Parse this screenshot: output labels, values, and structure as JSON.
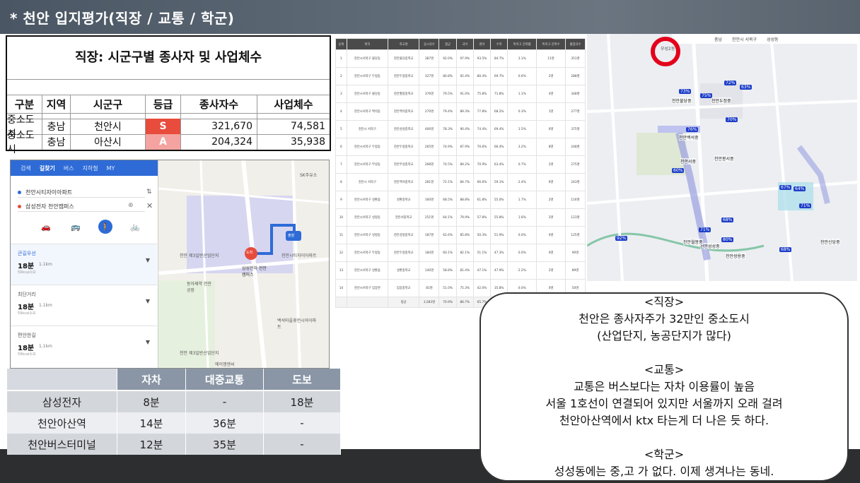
{
  "slide": {
    "title": "* 천안 입지평가(직장 / 교통 / 학군)"
  },
  "biz_table": {
    "title": "직장: 시군구별 종사자 및 사업체수",
    "headers": [
      "구분",
      "지역",
      "시군구",
      "등급",
      "종사자수",
      "사업체수"
    ],
    "rows": [
      {
        "type": "중소도시",
        "region": "충남",
        "city": "천안시",
        "grade": "S",
        "workers": "321,670",
        "businesses": "74,581"
      },
      {
        "type": "중소도시",
        "region": "충남",
        "city": "아산시",
        "grade": "A",
        "workers": "204,324",
        "businesses": "35,938"
      }
    ]
  },
  "map_app": {
    "tabs": [
      "검색",
      "길찾기",
      "버스",
      "지하철",
      "MY"
    ],
    "origin": "천안시티자이아파트",
    "destination": "삼성전자 천안캠퍼스",
    "options": [
      {
        "name": "큰길우선",
        "time": "18분",
        "dist": "1.1km",
        "sub": "59kcal소모"
      },
      {
        "name": "최단거리",
        "time": "18분",
        "dist": "1.1km",
        "sub": "59kcal소모"
      },
      {
        "name": "편안한길",
        "time": "18분",
        "dist": "1.1km",
        "sub": "59kcal소모"
      }
    ],
    "map_labels": {
      "a": "SK주유소",
      "b": "천안시티자이아파트",
      "c": "삼성전자 천안캠퍼스",
      "d": "천안 제3일반산업단지",
      "e": "동아제약 천안공장",
      "f": "백석마을휴먼시아아파트",
      "g": "천안 제3일반산업단지",
      "h": "에이엠엔씨",
      "i": "도착",
      "j": "출발"
    }
  },
  "travel_table": {
    "headers": [
      "",
      "자차",
      "대중교통",
      "도보"
    ],
    "rows": [
      [
        "삼성전자",
        "8분",
        "-",
        "18분"
      ],
      [
        "천안아산역",
        "14분",
        "36분",
        "-"
      ],
      [
        "천안버스터미널",
        "12분",
        "35분",
        "-"
      ]
    ]
  },
  "school_table": {
    "headers": [
      "순위",
      "위치",
      "학교명",
      "응시자수",
      "평균",
      "국어",
      "영어",
      "수학",
      "특목고 진학률",
      "특목고 진학수",
      "졸업자수"
    ],
    "rows": [
      [
        "1",
        "천안시서북구 불당동",
        "천안불당중학교",
        "387명",
        "92.0%",
        "97.9%",
        "93.5%",
        "84.7%",
        "3.1%",
        "11명",
        "351명"
      ],
      [
        "2",
        "천안시서북구 두정동",
        "천안두정중학교",
        "327명",
        "80.8%",
        "92.4%",
        "80.4%",
        "69.7%",
        "0.6%",
        "2명",
        "288명"
      ],
      [
        "3",
        "천안시서북구 불당동",
        "천안월봉중학교",
        "376명",
        "79.5%",
        "91.0%",
        "75.8%",
        "71.8%",
        "1.1%",
        "4명",
        "348명"
      ],
      [
        "4",
        "천안시서북구 백석동",
        "천안백석중학교",
        "270명",
        "79.4%",
        "89.3%",
        "77.8%",
        "68.2%",
        "0.3%",
        "1명",
        "277명"
      ],
      [
        "5",
        "천안시 서북구",
        "천안성성중학교",
        "406명",
        "78.3%",
        "90.4%",
        "74.4%",
        "69.4%",
        "1.5%",
        "6명",
        "375명"
      ],
      [
        "6",
        "천안시서북구 두정동",
        "천안두정중학교",
        "265명",
        "74.9%",
        "87.9%",
        "70.6%",
        "66.4%",
        "3.2%",
        "8명",
        "248명"
      ],
      [
        "7",
        "천안시서북구 부성동",
        "천안부성중학교",
        "268명",
        "74.5%",
        "89.2%",
        "70.9%",
        "63.4%",
        "0.7%",
        "2명",
        "275명"
      ],
      [
        "8",
        "천안시 서북구",
        "천안백석중학교",
        "281명",
        "72.1%",
        "84.7%",
        "66.6%",
        "59.1%",
        "2.4%",
        "6명",
        "243명"
      ],
      [
        "9",
        "천안시서북구 성환읍",
        "성환중학교",
        "160명",
        "68.5%",
        "88.8%",
        "61.8%",
        "55.0%",
        "1.7%",
        "2명",
        "116명"
      ],
      [
        "10",
        "천안시서북구 성정동",
        "천안서중학교",
        "251명",
        "64.1%",
        "79.9%",
        "57.8%",
        "55.8%",
        "1.6%",
        "2명",
        "123명"
      ],
      [
        "11",
        "천안시서북구 성정동",
        "천안성정중학교",
        "187명",
        "62.6%",
        "85.8%",
        "50.3%",
        "51.9%",
        "0.0%",
        "0명",
        "125명"
      ],
      [
        "12",
        "천안시서북구 두정동",
        "천안두정중학교",
        "184명",
        "60.1%",
        "82.1%",
        "51.1%",
        "47.3%",
        "0.0%",
        "0명",
        "90명"
      ],
      [
        "13",
        "천안시서북구 성환읍",
        "성환중학교",
        "140명",
        "58.8%",
        "81.4%",
        "47.1%",
        "47.9%",
        "2.2%",
        "2명",
        "89명"
      ],
      [
        "14",
        "천안시서북구 입장면",
        "입장중학교",
        "81명",
        "51.0%",
        "75.3%",
        "42.0%",
        "35.8%",
        "0.0%",
        "0명",
        "50명"
      ]
    ],
    "footer": [
      "",
      "",
      "평균",
      "3,583명",
      "70.9%",
      "86.7%",
      "65.7%",
      "60.4%",
      "1.3%",
      "47명",
      "2,998명"
    ]
  },
  "district_map": {
    "tabs": [
      "충남",
      "천안시 서북구",
      "성성동"
    ],
    "place_label": "부성2동",
    "badges": [
      "73%",
      "75%",
      "72%",
      "63%",
      "70%",
      "76%",
      "60%",
      "67%",
      "64%",
      "71%",
      "71%",
      "68%",
      "80%",
      "92%",
      "68%"
    ],
    "schools": [
      "천안불당중",
      "천안두정중",
      "천안백석중",
      "천안서중",
      "천안봉서중",
      "천안성성중",
      "천안월봉중",
      "천안쌍용중",
      "천안신당중"
    ]
  },
  "summary": {
    "work_h": "<직장>",
    "work_1": "천안은 종사자주가 32만인 중소도시",
    "work_2": "(산업단지, 농공단지가 많다)",
    "traffic_h": "<교통>",
    "traffic_1": "교통은 버스보다는 자차 이용률이 높음",
    "traffic_2": "서울 1호선이 연결되어 있지만 서울까지 오래 걸려",
    "traffic_3": "천안아산역에서 ktx 타는게 더 나은 듯 하다.",
    "school_h": "<학군>",
    "school_1": "성성동에는 중,고 가 없다. 이제 생겨나는 동네."
  },
  "colors": {
    "grade_s": "#e74c3c",
    "grade_a": "#f4a3a0",
    "accent_blue": "#2e6bd6",
    "red_circle": "#e3001b"
  }
}
